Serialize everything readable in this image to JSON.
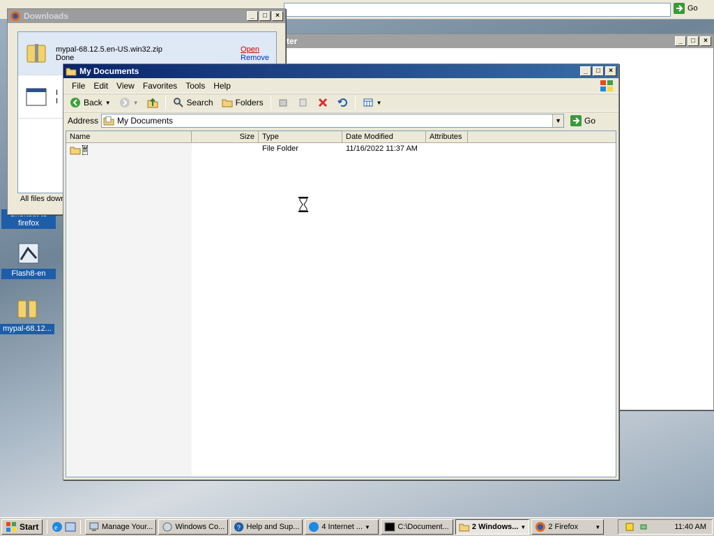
{
  "background_ie": {
    "go_label": "Go"
  },
  "background_window": {
    "title": "ter"
  },
  "desktop_icons": [
    {
      "label": "Shortcut to firefox"
    },
    {
      "label": "Flash8-en"
    },
    {
      "label": "mypal-68.12..."
    }
  ],
  "downloads": {
    "title": "Downloads",
    "items": [
      {
        "name": "mypal-68.12.5.en-US.win32.zip",
        "status": "Done",
        "open": "Open",
        "remove": "Remove"
      },
      {
        "name": "I",
        "status": "I"
      }
    ],
    "footer": "All files dowr"
  },
  "mydocs": {
    "title": "My Documents",
    "menu": [
      "File",
      "Edit",
      "View",
      "Favorites",
      "Tools",
      "Help"
    ],
    "toolbar": {
      "back": "Back",
      "search": "Search",
      "folders": "Folders"
    },
    "address_label": "Address",
    "address_value": "My Documents",
    "go_label": "Go",
    "columns": [
      "Name",
      "Size",
      "Type",
      "Date Modified",
      "Attributes"
    ],
    "rows": [
      {
        "name": "ff",
        "size": "",
        "type": "File Folder",
        "modified": "11/16/2022 11:37 AM",
        "attributes": ""
      }
    ]
  },
  "taskbar": {
    "start": "Start",
    "tasks": [
      {
        "label": "Manage Your..."
      },
      {
        "label": "Windows Co..."
      },
      {
        "label": "Help and Sup..."
      },
      {
        "label": "4 Internet ..."
      },
      {
        "label": "C:\\Document..."
      },
      {
        "label": "2 Windows..."
      },
      {
        "label": "2 Firefox"
      }
    ],
    "clock": "11:40 AM"
  }
}
